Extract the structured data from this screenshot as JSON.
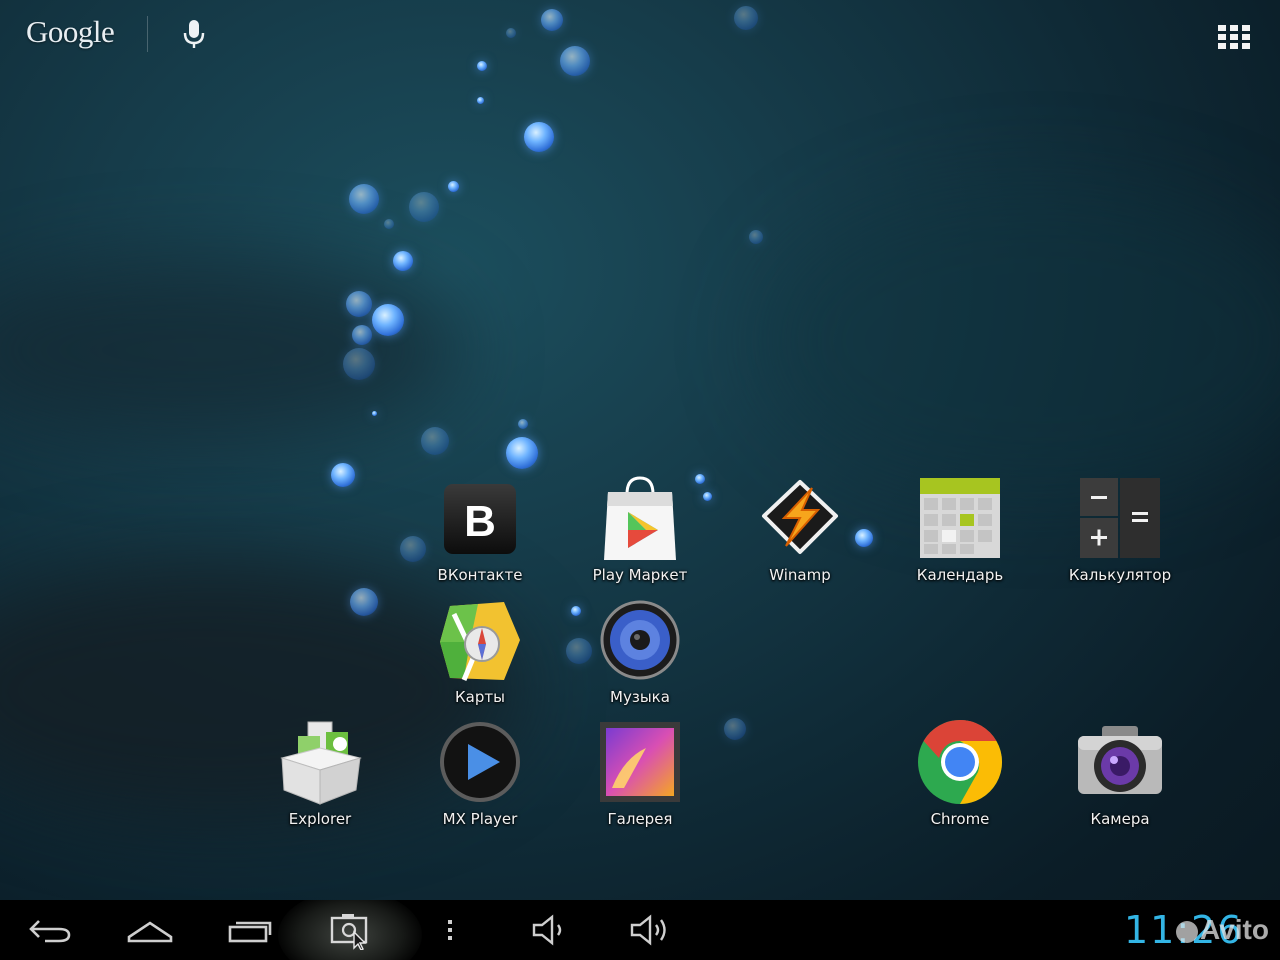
{
  "search_bar": {
    "logo_text": "Google",
    "icons": [
      "microphone-icon",
      "all-apps-grid-icon"
    ]
  },
  "apps": [
    {
      "label": "ВКонтакте",
      "icon": "vkontakte-icon",
      "glyph": "В"
    },
    {
      "label": "Play Маркет",
      "icon": "play-market-icon"
    },
    {
      "label": "Winamp",
      "icon": "winamp-icon"
    },
    {
      "label": "Календарь",
      "icon": "calendar-icon"
    },
    {
      "label": "Калькулятор",
      "icon": "calculator-icon"
    },
    {
      "label": "Карты",
      "icon": "maps-icon"
    },
    {
      "label": "Музыка",
      "icon": "music-icon"
    },
    {
      "label": "Explorer",
      "icon": "explorer-icon"
    },
    {
      "label": "MX Player",
      "icon": "mx-player-icon"
    },
    {
      "label": "Галерея",
      "icon": "gallery-icon"
    },
    {
      "label": "Chrome",
      "icon": "chrome-icon"
    },
    {
      "label": "Камера",
      "icon": "camera-icon"
    }
  ],
  "navbar": {
    "buttons": [
      "back-icon",
      "home-icon",
      "recent-apps-icon",
      "screenshot-icon",
      "menu-icon",
      "volume-down-icon",
      "volume-up-icon"
    ],
    "clock": "11:26"
  },
  "watermark": "Avito",
  "colors": {
    "clock": "#33b5e5",
    "navbar_bg": "#000000",
    "label_text": "#f2f2f2"
  }
}
